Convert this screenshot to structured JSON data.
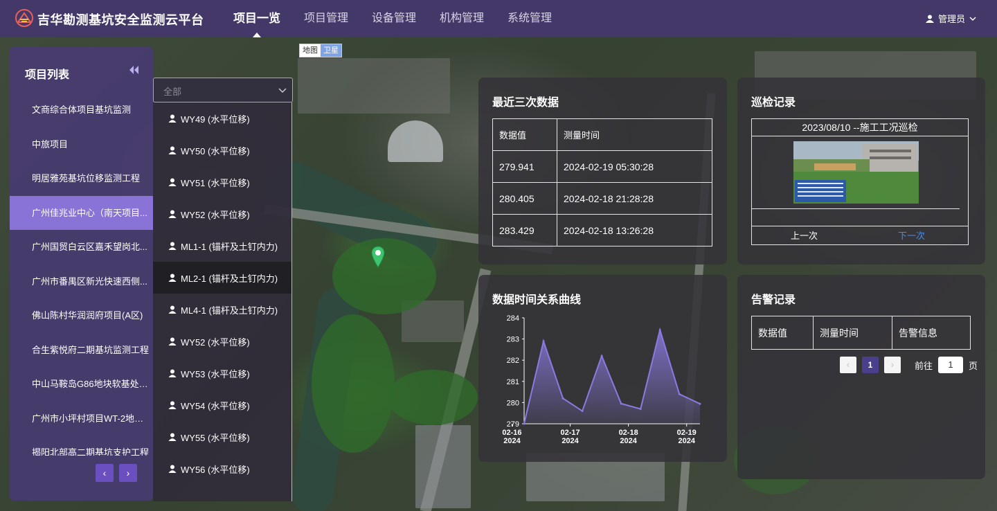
{
  "app": {
    "title": "吉华勘测基坑安全监测云平台",
    "user": "管理员"
  },
  "nav": [
    {
      "label": "项目一览",
      "active": true
    },
    {
      "label": "项目管理",
      "active": false
    },
    {
      "label": "设备管理",
      "active": false
    },
    {
      "label": "机构管理",
      "active": false
    },
    {
      "label": "系统管理",
      "active": false
    }
  ],
  "map_toggle": {
    "map": "地图",
    "satellite": "卫星"
  },
  "project_panel": {
    "title": "项目列表",
    "items": [
      "文商综合体项目基坑监测",
      "中旅项目",
      "明居雅苑基坑位移监测工程",
      "广州佳兆业中心（南天项目...",
      "广州国贸白云区嘉禾望岗北...",
      "广州市番禺区新光快速西侧...",
      "佛山陈村华润润府项目(A区)",
      "合生紫悦府二期基坑监测工程",
      "中山马鞍岛G86地块软基处理...",
      "广州市小坪村项目WT-2地块...",
      "揭阳北部高二期基坑支护工程"
    ],
    "active_index": 3,
    "prev": "‹",
    "next": "›"
  },
  "point_select": {
    "placeholder": "全部",
    "items": [
      "WY49 (水平位移)",
      "WY50 (水平位移)",
      "WY51 (水平位移)",
      "WY52 (水平位移)",
      "ML1-1 (锚杆及土钉内力)",
      "ML2-1 (锚杆及土钉内力)",
      "ML4-1 (锚杆及土钉内力)",
      "WY52 (水平位移)",
      "WY53 (水平位移)",
      "WY54 (水平位移)",
      "WY55 (水平位移)",
      "WY56 (水平位移)"
    ],
    "active_index": 5
  },
  "recent": {
    "title": "最近三次数据",
    "headers": [
      "数据值",
      "测量时间"
    ],
    "rows": [
      [
        "279.941",
        "2024-02-19 05:30:28"
      ],
      [
        "280.405",
        "2024-02-18 21:28:28"
      ],
      [
        "283.429",
        "2024-02-18 13:26:28"
      ]
    ]
  },
  "patrol": {
    "title": "巡检记录",
    "header": "2023/08/10 --施工工况巡检",
    "prev": "上一次",
    "next": "下一次"
  },
  "curve": {
    "title": "数据时间关系曲线"
  },
  "alarm": {
    "title": "告警记录",
    "headers": [
      "数据值",
      "测量时间",
      "告警信息"
    ],
    "pager": {
      "prev": "‹",
      "page": "1",
      "next": "›",
      "goto": "前往",
      "input": "1",
      "unit": "页"
    }
  },
  "colors": {
    "nav_bg": "#433867",
    "accent": "#8a73d6",
    "line": "#8b7ae0"
  },
  "chart_data": {
    "type": "area",
    "title": "数据时间关系曲线",
    "ylim": [
      279,
      284
    ],
    "yticks": [
      "279",
      "280",
      "281",
      "282",
      "283",
      "284"
    ],
    "xticks": [
      {
        "date": "02-16",
        "year": "2024"
      },
      {
        "date": "02-17",
        "year": "2024"
      },
      {
        "date": "02-18",
        "year": "2024"
      },
      {
        "date": "02-19",
        "year": "2024"
      }
    ],
    "x": [
      "2024-02-16 05:00",
      "2024-02-16 13:00",
      "2024-02-16 21:00",
      "2024-02-17 05:00",
      "2024-02-17 13:00",
      "2024-02-17 21:00",
      "2024-02-18 05:00",
      "2024-02-18 13:00",
      "2024-02-18 21:00",
      "2024-02-19 05:30"
    ],
    "series": [
      {
        "values": [
          279.0,
          282.9,
          280.2,
          279.6,
          282.2,
          279.95,
          279.7,
          283.43,
          280.4,
          279.94
        ]
      }
    ]
  }
}
